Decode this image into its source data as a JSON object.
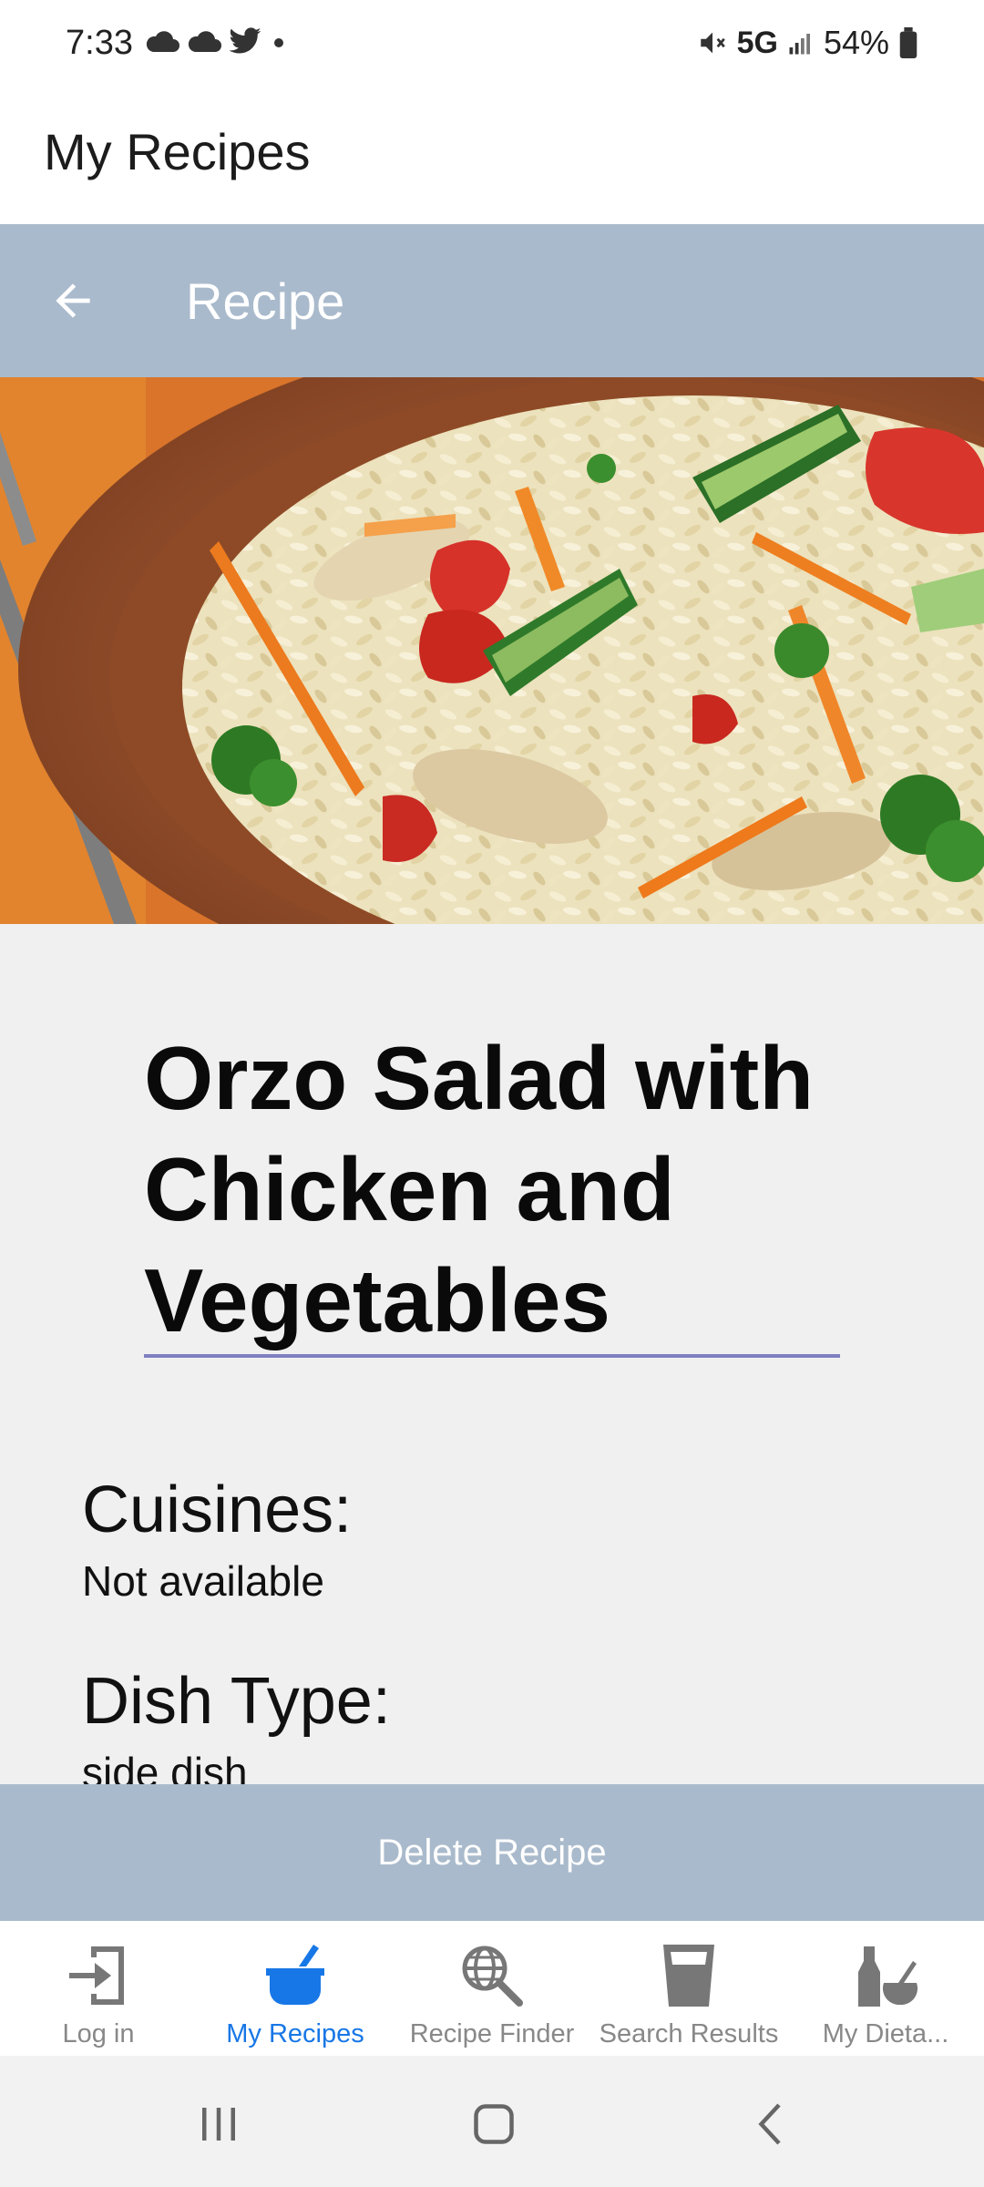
{
  "status_bar": {
    "time": "7:33",
    "network": "5G",
    "battery": "54%",
    "left_icons": [
      "cloud-icon",
      "cloud-icon",
      "twitter-icon",
      "dot-icon"
    ],
    "right_icons": [
      "mute-icon",
      "signal-icon",
      "battery-icon"
    ]
  },
  "app": {
    "title": "My Recipes"
  },
  "toolbar": {
    "title": "Recipe",
    "back_icon": "arrow-left-icon"
  },
  "recipe": {
    "title": "Orzo Salad with Chicken and Vegetables",
    "fields": [
      {
        "label": "Cuisines:",
        "value": "Not available"
      },
      {
        "label": "Dish Type:",
        "value": "side dish"
      }
    ]
  },
  "actions": {
    "delete_label": "Delete Recipe"
  },
  "bottom_nav": {
    "accent_color": "#1877e6",
    "items": [
      {
        "label": "Log in",
        "icon": "login-icon",
        "active": false
      },
      {
        "label": "My Recipes",
        "icon": "cooking-pot-icon",
        "active": true
      },
      {
        "label": "Recipe Finder",
        "icon": "globe-search-icon",
        "active": false
      },
      {
        "label": "Search Results",
        "icon": "cup-icon",
        "active": false
      },
      {
        "label": "My Dieta...",
        "icon": "mortar-bottle-icon",
        "active": false
      }
    ]
  },
  "system_nav": {
    "buttons": [
      "recents-icon",
      "home-icon",
      "back-icon"
    ]
  }
}
